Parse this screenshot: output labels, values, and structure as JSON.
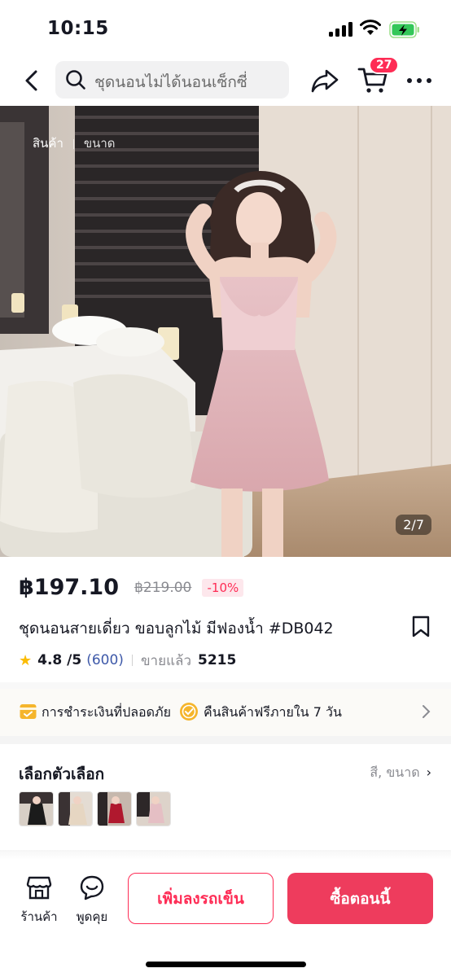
{
  "status_bar": {
    "time": "10:15"
  },
  "header": {
    "search_text": "ชุดนอนไม่ได้นอนเซ็กซี่",
    "cart_count": "27"
  },
  "gallery": {
    "tab_product": "สินค้า",
    "tab_size": "ขนาด",
    "counter": "2/7"
  },
  "product": {
    "price": "฿197.10",
    "original_price": "฿219.00",
    "discount": "-10%",
    "title": "ชุดนอนสายเดี่ยว ขอบลูกไม้ มีฟองน้ำ #DB042",
    "rating": "4.8 /5",
    "review_count": "(600)",
    "sold_label": "ขายแล้ว",
    "sold_count": "5215"
  },
  "guarantee": {
    "secure_payment": "การชำระเงินที่ปลอดภัย",
    "free_return": "คืนสินค้าฟรีภายใน 7 วัน"
  },
  "options": {
    "title": "เลือกตัวเลือก",
    "summary": "สี, ขนาด"
  },
  "bottom_bar": {
    "shop_label": "ร้านค้า",
    "chat_label": "พูดคุย",
    "add_to_cart": "เพิ่มลงรถเข็น",
    "buy_now": "ซื้อตอนนี้"
  },
  "colors": {
    "accent": "#fe2c55",
    "buy_button": "#ee3c5d",
    "star": "#fbbc04",
    "link": "#3e59a9"
  }
}
